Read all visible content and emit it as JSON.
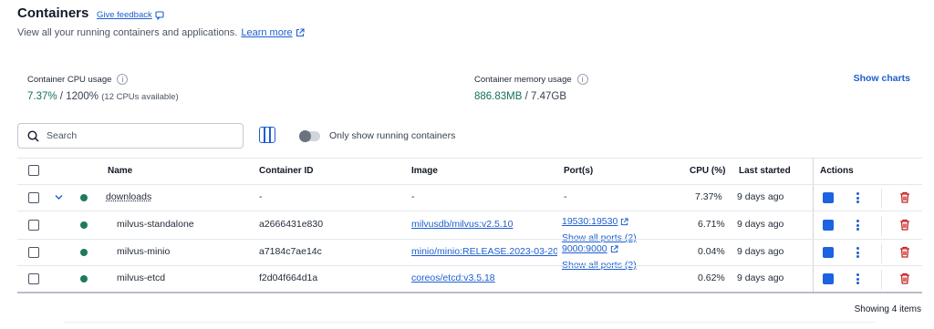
{
  "header": {
    "title": "Containers",
    "feedback_label": "Give feedback",
    "subtitle": "View all your running containers and applications.",
    "learn_more": "Learn more"
  },
  "stats": {
    "cpu": {
      "label": "Container CPU usage",
      "value": "7.37%",
      "separator": " / 1200%",
      "note": "(12 CPUs available)"
    },
    "memory": {
      "label": "Container memory usage",
      "value": "886.83MB",
      "separator": " / 7.47GB"
    },
    "show_charts": "Show charts"
  },
  "toolbar": {
    "search_placeholder": "Search",
    "toggle_label": "Only show running containers",
    "toggle_on": false
  },
  "table": {
    "columns": {
      "name": "Name",
      "id": "Container ID",
      "image": "Image",
      "ports": "Port(s)",
      "cpu": "CPU (%)",
      "last_started": "Last started",
      "actions": "Actions"
    },
    "rows": [
      {
        "name": "downloads",
        "id": "-",
        "image": "-",
        "port": "-",
        "show_all_ports": "",
        "cpu": "7.37%",
        "last_started": "9 days ago"
      },
      {
        "name": "milvus-standalone",
        "id": "a2666431e830",
        "image": "milvusdb/milvus:v2.5.10",
        "port": "19530:19530",
        "show_all_ports": "Show all ports (2)",
        "cpu": "6.71%",
        "last_started": "9 days ago"
      },
      {
        "name": "milvus-minio",
        "id": "a7184c7ae14c",
        "image": "minio/minio:RELEASE.2023-03-20",
        "port": "9000:9000",
        "show_all_ports": "Show all ports (2)",
        "cpu": "0.04%",
        "last_started": "9 days ago"
      },
      {
        "name": "milvus-etcd",
        "id": "f2d04f664d1a",
        "image": "coreos/etcd:v3.5.18",
        "port": "",
        "show_all_ports": "",
        "cpu": "0.62%",
        "last_started": "9 days ago"
      }
    ]
  },
  "footer": {
    "count": "Showing 4 items"
  },
  "colors": {
    "accent": "#1d5fd0",
    "status_running": "#1e7a5e",
    "delete": "#c81e1e"
  }
}
